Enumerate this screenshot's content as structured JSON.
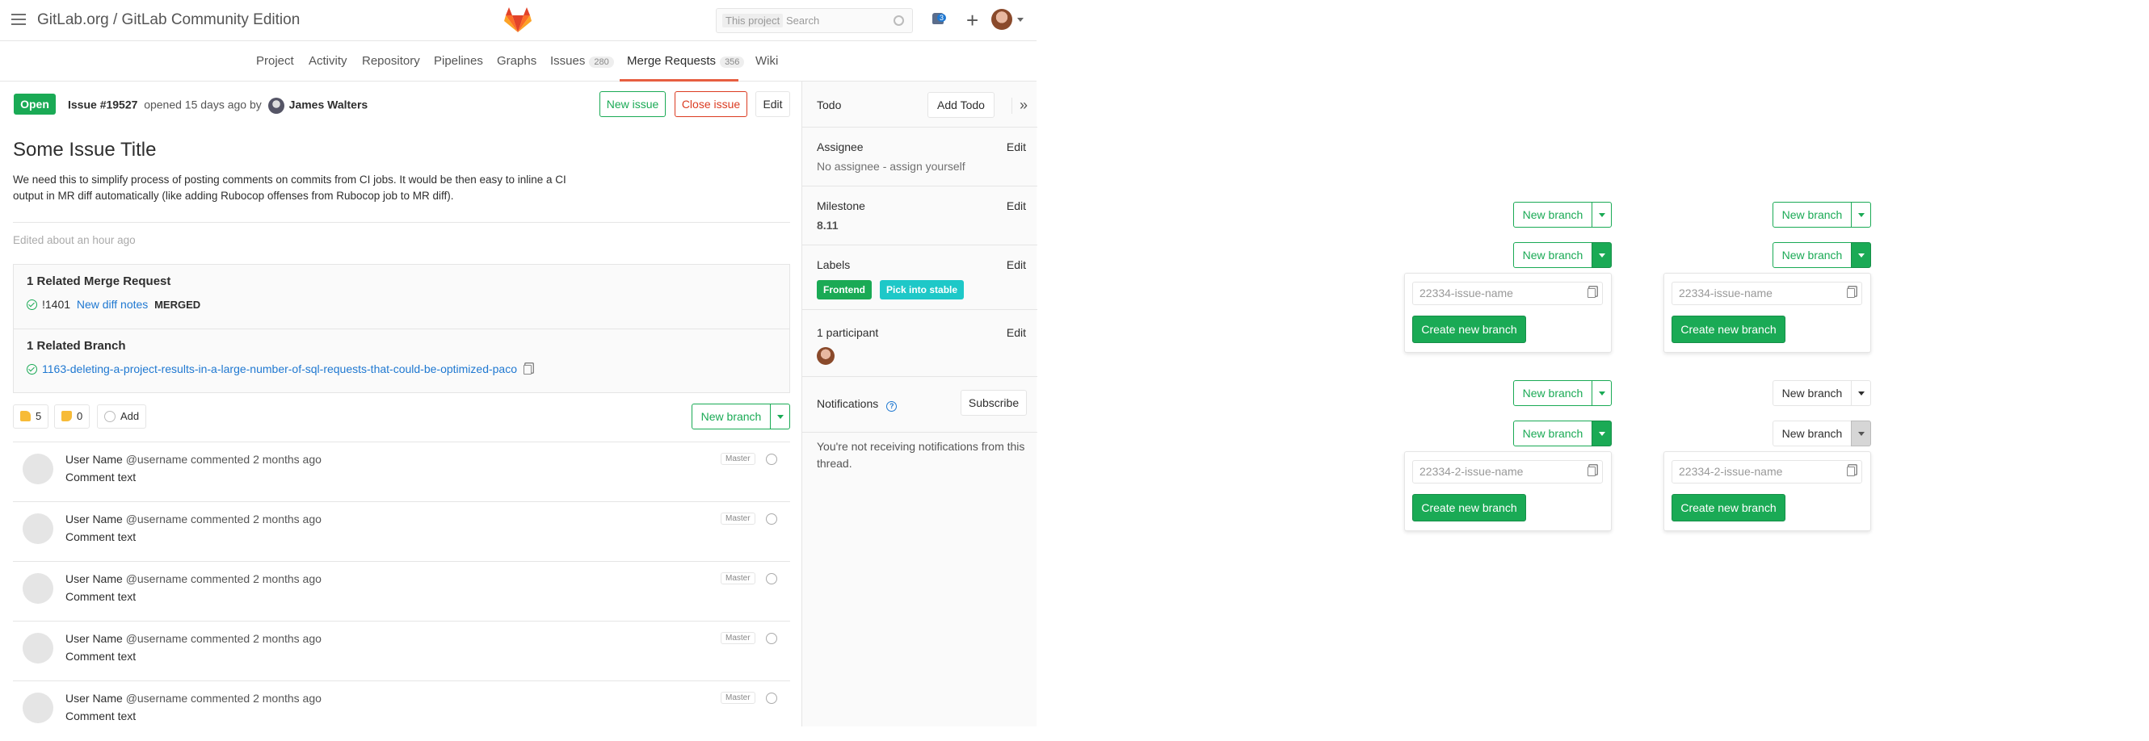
{
  "header": {
    "title": "GitLab.org / GitLab Community Edition",
    "search_scope": "This project",
    "search_placeholder": "Search",
    "notif_count": "3"
  },
  "nav": {
    "items": [
      {
        "label": "Project"
      },
      {
        "label": "Activity"
      },
      {
        "label": "Repository"
      },
      {
        "label": "Pipelines"
      },
      {
        "label": "Graphs"
      },
      {
        "label": "Issues",
        "count": "280"
      },
      {
        "label": "Merge Requests",
        "count": "356"
      },
      {
        "label": "Wiki"
      }
    ]
  },
  "issue": {
    "status": "Open",
    "number": "Issue #19527",
    "opened": "opened 15 days ago by",
    "author": "James Walters",
    "new_issue": "New issue",
    "close_issue": "Close issue",
    "edit": "Edit",
    "title": "Some Issue Title",
    "description": "We need this to simplify process of posting comments on commits from CI jobs. It would be then easy to inline a CI output in MR diff automatically (like adding Rubocop offenses from Rubocop job to MR diff).",
    "edited": "Edited about an hour ago"
  },
  "related": {
    "mr_title": "1 Related Merge Request",
    "mr_ref": "!1401",
    "mr_link": "New diff notes",
    "mr_state": "MERGED",
    "branch_title": "1 Related Branch",
    "branch_name": "1163-deleting-a-project-results-in-a-large-number-of-sql-requests-that-could-be-optimized-paco"
  },
  "awards": {
    "up": "5",
    "down": "0",
    "add": "Add"
  },
  "new_branch_label": "New branch",
  "comments": [
    {
      "name": "User Name",
      "handle": "@username",
      "meta": "commented 2 months ago",
      "text": "Comment text",
      "role": "Master"
    },
    {
      "name": "User Name",
      "handle": "@username",
      "meta": "commented 2 months ago",
      "text": "Comment text",
      "role": "Master"
    },
    {
      "name": "User Name",
      "handle": "@username",
      "meta": "commented 2 months ago",
      "text": "Comment text",
      "role": "Master"
    },
    {
      "name": "User Name",
      "handle": "@username",
      "meta": "commented 2 months ago",
      "text": "Comment text",
      "role": "Master"
    },
    {
      "name": "User Name",
      "handle": "@username",
      "meta": "commented 2 months ago",
      "text": "Comment text",
      "role": "Master"
    }
  ],
  "sidebar": {
    "todo": "Todo",
    "add_todo": "Add Todo",
    "assignee": "Assignee",
    "assignee_value": "No assignee - assign yourself",
    "milestone": "Milestone",
    "milestone_value": "8.11",
    "labels": "Labels",
    "label_list": [
      {
        "name": "Frontend",
        "color": "#1aaa55"
      },
      {
        "name": "Pick into stable",
        "color": "#1ec8c8"
      }
    ],
    "participants": "1 participant",
    "notifications": "Notifications",
    "subscribe": "Subscribe",
    "notif_text": "You're not receiving notifications from this thread.",
    "edit": "Edit"
  },
  "states": {
    "input_value_1": "22334-issue-name",
    "input_value_2": "22334-2-issue-name",
    "create_label": "Create new branch"
  },
  "colors": {
    "green": "#1aaa55",
    "red": "#db3b21",
    "link": "#1f78d1",
    "tab_underline": "#e75e40"
  }
}
